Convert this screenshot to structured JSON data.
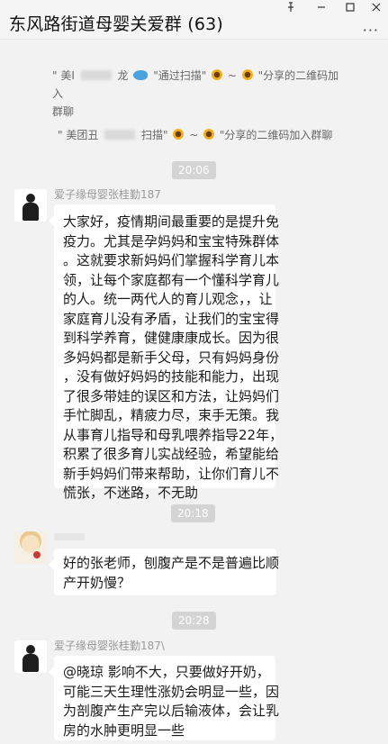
{
  "window": {
    "title": "东风路街道母婴关爱群 (63)",
    "pin_icon": "pin-icon",
    "minimize_icon": "minimize-icon",
    "maximize_icon": "maximize-icon",
    "close_icon": "close-icon",
    "more_icon": "more-icon",
    "more_glyph": "···"
  },
  "system_notices": [
    {
      "part1": "\" 美I",
      "part2": "龙",
      "part3": "\"通过扫描\"",
      "part4": " ~ ",
      "part5": "\"分享的二维码加入",
      "part6": "群聊"
    },
    {
      "part1": "\" 美团丑",
      "part2": "扫描\"",
      "part3": " ~ ",
      "part4": "\"分享的二维码加入群聊"
    }
  ],
  "timestamps": [
    "20:06",
    "20:18",
    "20:28"
  ],
  "messages": [
    {
      "sender": "爱子缘母婴张桂勤187",
      "lines": [
        "大家好，疫情期间最重要的是提升免",
        "疫力。尤其是孕妈妈和宝宝特殊群体",
        "。这就要求新妈妈们掌握科学育儿本",
        "领，让每个家庭都有一个懂科学育儿",
        "的人。统一两代人的育儿观念，，让",
        "家庭育儿没有矛盾，让我们的宝宝得",
        "到科学养育，健健康康成长。因为很",
        "多妈妈都是新手父母，只有妈妈身份",
        "，没有做好妈妈的技能和能力，出现",
        "了很多带娃的误区和方法，让妈妈们",
        "手忙脚乱，精疲力尽，束手无策。我",
        "从事育儿指导和母乳喂养指导22年，",
        "积累了很多育儿实战经验，希望能给",
        "新手妈妈们带来帮助，让你们育儿不",
        "慌张，不迷路，不无助"
      ]
    },
    {
      "sender": "",
      "lines": [
        "好的张老师，刨腹产是不是普遍比顺",
        "产开奶慢？"
      ]
    },
    {
      "sender": "爱子缘母婴张桂勤187\\",
      "lines": [
        "@晓琼 影响不大，只要做好开奶，",
        "可能三天生理性涨奶会明显一些，因",
        "为剖腹产生产完以后输液体，会让乳",
        "房的水肿更明显一些"
      ]
    }
  ]
}
